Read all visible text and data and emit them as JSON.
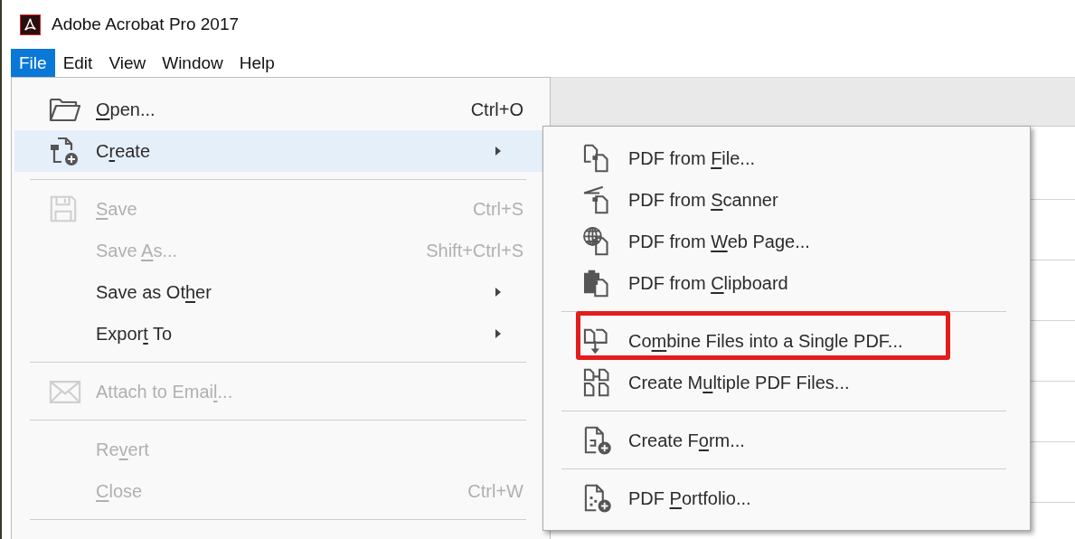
{
  "window": {
    "title": "Adobe Acrobat Pro 2017"
  },
  "menu_bar": [
    {
      "label": "File",
      "selected": true
    },
    {
      "label": "Edit",
      "selected": false
    },
    {
      "label": "View",
      "selected": false
    },
    {
      "label": "Window",
      "selected": false
    },
    {
      "label": "Help",
      "selected": false
    }
  ],
  "file_menu": {
    "groups": [
      [
        {
          "key": "O",
          "post": "pen...",
          "shortcut": "Ctrl+O",
          "disabled": false,
          "selected": false,
          "submenu": false
        },
        {
          "pre": "C",
          "key": "r",
          "post": "eate",
          "disabled": false,
          "selected": true,
          "submenu": true
        }
      ],
      [
        {
          "key": "S",
          "post": "ave",
          "shortcut": "Ctrl+S",
          "disabled": true,
          "selected": false,
          "submenu": false
        },
        {
          "pre": "Save ",
          "key": "A",
          "post": "s...",
          "shortcut": "Shift+Ctrl+S",
          "disabled": true,
          "selected": false,
          "submenu": false
        },
        {
          "pre": "Save as Ot",
          "key": "h",
          "post": "er",
          "disabled": false,
          "selected": false,
          "submenu": true
        },
        {
          "pre": "Expor",
          "key": "t",
          "post": " To",
          "disabled": false,
          "selected": false,
          "submenu": true
        }
      ],
      [
        {
          "pre": "Attach to Emai",
          "key": "l",
          "post": "...",
          "disabled": true,
          "selected": false,
          "submenu": false
        }
      ],
      [
        {
          "pre": "Re",
          "key": "v",
          "post": "ert",
          "disabled": true,
          "selected": false,
          "submenu": false
        },
        {
          "key": "C",
          "post": "lose",
          "shortcut": "Ctrl+W",
          "disabled": true,
          "selected": false,
          "submenu": false
        }
      ]
    ]
  },
  "create_submenu": {
    "groups": [
      [
        {
          "pre": "PDF from ",
          "key": "F",
          "post": "ile...",
          "annotated": false
        },
        {
          "pre": "PDF from ",
          "key": "S",
          "post": "canner",
          "annotated": false
        },
        {
          "pre": "PDF from ",
          "key": "W",
          "post": "eb Page...",
          "annotated": false
        },
        {
          "pre": "PDF from ",
          "key": "C",
          "post": "lipboard",
          "annotated": false
        }
      ],
      [
        {
          "pre": "Co",
          "key": "m",
          "post": "bine Files into a Single PDF...",
          "annotated": true
        },
        {
          "pre": "Create M",
          "key": "u",
          "post": "ltiple PDF Files...",
          "annotated": false
        }
      ],
      [
        {
          "pre": "Create F",
          "key": "o",
          "post": "rm...",
          "annotated": false
        }
      ],
      [
        {
          "pre": "PDF ",
          "key": "P",
          "post": "ortfolio...",
          "annotated": false
        }
      ]
    ]
  }
}
